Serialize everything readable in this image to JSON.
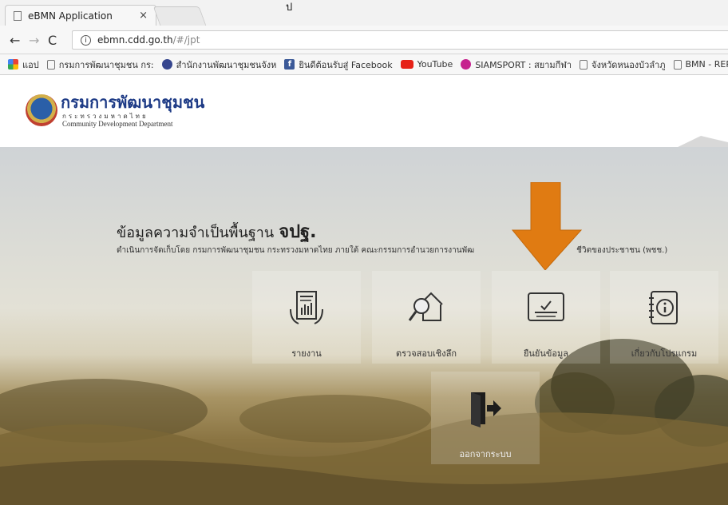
{
  "browser": {
    "tab_title": "eBMN Application",
    "tab_close": "×",
    "top_glyph": "ป",
    "url_domain": "ebmn.cdd.go.th",
    "url_path": "/#/jpt"
  },
  "bookmarks": [
    {
      "label": "แอป",
      "icon": "apps-icon"
    },
    {
      "label": "กรมการพัฒนาชุมชน กร:",
      "icon": "page-icon"
    },
    {
      "label": "สำนักงานพัฒนาชุมชนจังห",
      "icon": "dept-icon"
    },
    {
      "label": "ยินดีต้อนรับสู่ Facebook",
      "icon": "facebook-icon"
    },
    {
      "label": "YouTube",
      "icon": "youtube-icon"
    },
    {
      "label": "SIAMSPORT : สยามกีฬา",
      "icon": "siamsport-icon"
    },
    {
      "label": "จังหวัดหนองบัวลำภู",
      "icon": "page-icon"
    },
    {
      "label": "BMN - REPOR",
      "icon": "page-icon"
    }
  ],
  "header": {
    "org_name_th": "กรมการพัฒนาชุมชน",
    "org_sub_th": "กระทรวงมหาดไทย",
    "org_name_en": "Community Development Department"
  },
  "hero": {
    "title": "ข้อมูลความจำเป็นพื้นฐาน",
    "title_bold": "จปฐ.",
    "description": "ดำเนินการจัดเก็บโดย กรมการพัฒนาชุมชน กระทรวงมหาดไทย ภายใต้ คณะกรรมการอำนวยการงานพัฒ",
    "description_tail": "ชีวิตของประชาชน (พชช.)"
  },
  "tiles": [
    {
      "label": "รายงาน",
      "icon": "report-icon"
    },
    {
      "label": "ตรวจสอบเชิงลึก",
      "icon": "inspect-house-icon"
    },
    {
      "label": "ยืนยันข้อมูล",
      "icon": "confirm-data-icon"
    },
    {
      "label": "เกี่ยวกับโปรแกรม",
      "icon": "info-book-icon"
    },
    {
      "label": "ออกจากระบบ",
      "icon": "logout-icon"
    }
  ],
  "colors": {
    "arrow": "#e07b12",
    "brand": "#1e3b86"
  }
}
